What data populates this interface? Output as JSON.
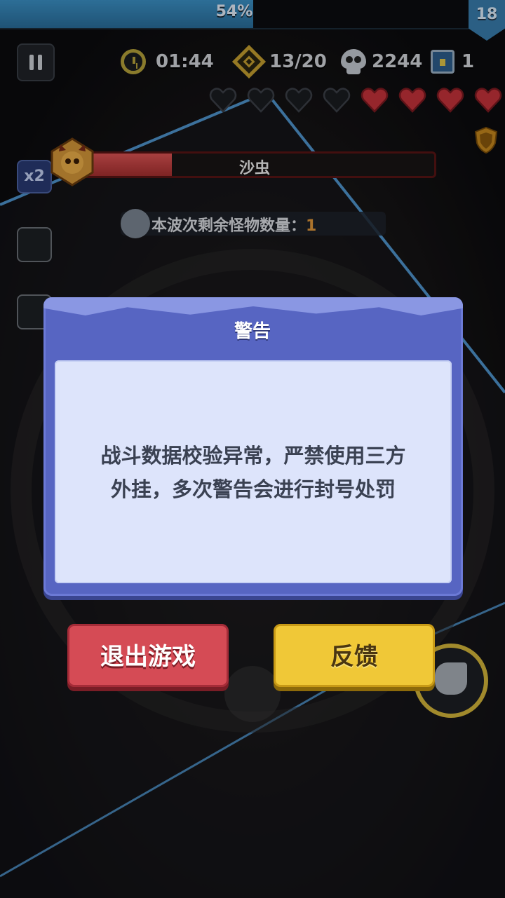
{
  "progress": {
    "text": "54%",
    "value": 0.54
  },
  "level": "18",
  "hud": {
    "timer": "01:44",
    "wave": "13/20",
    "kills": "2244",
    "chests": "1"
  },
  "hearts": {
    "empty": 4,
    "full": 4
  },
  "boss": {
    "name": "沙虫",
    "health": 0.27
  },
  "speed_label": "x2",
  "wave_info": {
    "label": "本波次剩余怪物数量：",
    "count": "1"
  },
  "dialog": {
    "title": "警告",
    "message_line1": "战斗数据校验异常，严禁使用三方",
    "message_line2": "外挂，多次警告会进行封号处罚"
  },
  "buttons": {
    "exit": "退出游戏",
    "feedback": "反馈"
  },
  "colors": {
    "dialog": "#5765c2",
    "exit_button": "#d54b55",
    "feedback_button": "#f0c837",
    "heart_full": "#c9333b"
  }
}
